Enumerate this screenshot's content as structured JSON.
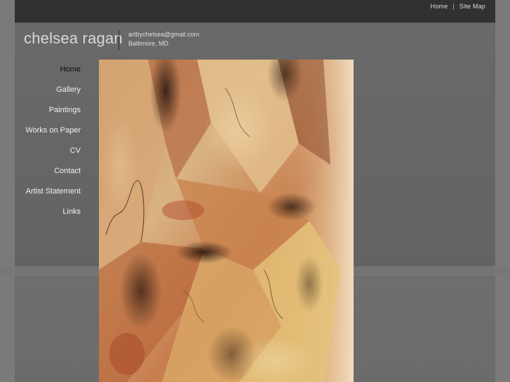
{
  "header": {
    "nav": [
      {
        "label": "Home"
      },
      {
        "label": "Site Map"
      }
    ],
    "separator": "|"
  },
  "site": {
    "title": "chelsea ragan",
    "email": "artbychelsea@gmail.com",
    "location": "Baltimore, MD"
  },
  "sidebar": {
    "active": "Home",
    "items": [
      {
        "label": "Home"
      },
      {
        "label": "Gallery"
      },
      {
        "label": "Paintings"
      },
      {
        "label": "Works on Paper"
      },
      {
        "label": "CV"
      },
      {
        "label": "Contact"
      },
      {
        "label": "Artist Statement"
      },
      {
        "label": "Links"
      }
    ]
  },
  "colors": {
    "topbar": "#313131",
    "page": "#666666",
    "active_nav": "#0c0c0c",
    "nav_text": "#f2f2f2"
  }
}
